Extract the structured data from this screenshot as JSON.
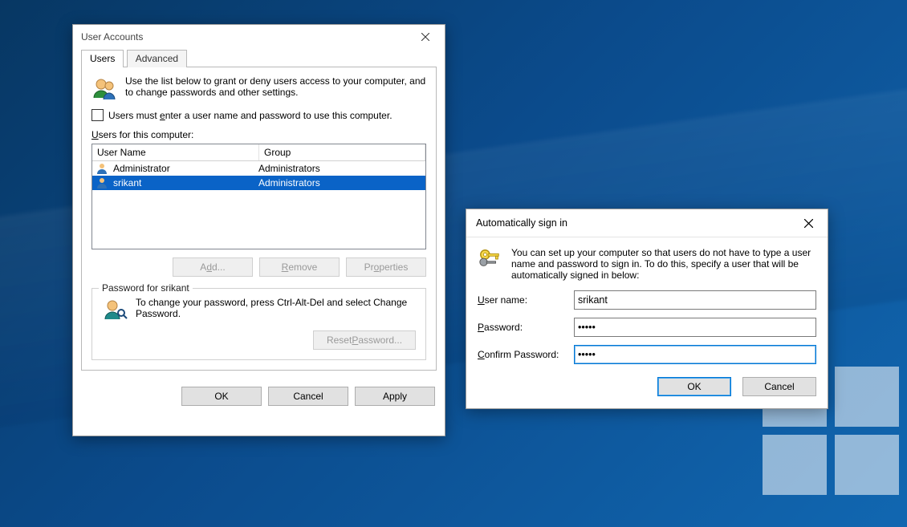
{
  "ua": {
    "title": "User Accounts",
    "tabs": {
      "users": "Users",
      "advanced": "Advanced"
    },
    "intro": "Use the list below to grant or deny users access to your computer, and to change passwords and other settings.",
    "checkbox_text_pre": "Users must ",
    "checkbox_accel": "e",
    "checkbox_text_post": "nter a user name and password to use this computer.",
    "list_label_accel": "U",
    "list_label_rest": "sers for this computer:",
    "columns": {
      "user": "User Name",
      "group": "Group"
    },
    "rows": [
      {
        "user": "Administrator",
        "group": "Administrators",
        "selected": false
      },
      {
        "user": "srikant",
        "group": "Administrators",
        "selected": true
      }
    ],
    "buttons": {
      "add_pre": "A",
      "add_ul": "d",
      "add_post": "d...",
      "remove_ul": "R",
      "remove_post": "emove",
      "properties_pre": "Pr",
      "properties_ul": "o",
      "properties_post": "perties",
      "reset_pre": "Reset ",
      "reset_ul": "P",
      "reset_post": "assword..."
    },
    "password_group_title": "Password for srikant",
    "password_group_text": "To change your password, press Ctrl-Alt-Del and select Change Password.",
    "dlg": {
      "ok": "OK",
      "cancel": "Cancel",
      "apply": "Apply"
    }
  },
  "asd": {
    "title": "Automatically sign in",
    "intro": "You can set up your computer so that users do not have to type a user name and password to sign in. To do this, specify a user that will be automatically signed in below:",
    "labels": {
      "user_ul": "U",
      "user_rest": "ser name:",
      "pass_ul": "P",
      "pass_rest": "assword:",
      "conf_pre": "",
      "conf_ul": "C",
      "conf_rest": "onfirm Password:"
    },
    "values": {
      "user": "srikant",
      "pass": "•••••",
      "confirm": "•••••"
    },
    "ok": "OK",
    "cancel": "Cancel"
  }
}
